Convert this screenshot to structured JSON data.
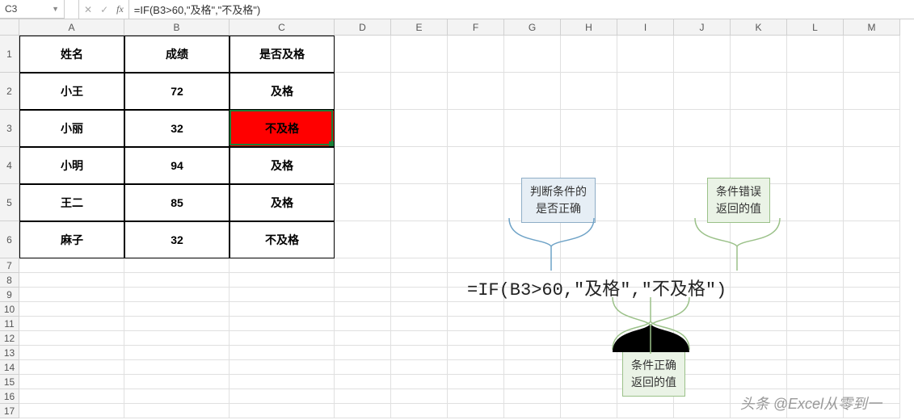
{
  "namebox": "C3",
  "formula": "=IF(B3>60,\"及格\",\"不及格\")",
  "columns": [
    "A",
    "B",
    "C",
    "D",
    "E",
    "F",
    "G",
    "H",
    "I",
    "J",
    "K",
    "L",
    "M"
  ],
  "rows_tall": [
    1,
    2,
    3,
    4,
    5,
    6
  ],
  "rows_short": [
    7,
    8,
    9,
    10,
    11,
    12,
    13,
    14,
    15,
    16,
    17
  ],
  "table": {
    "header": [
      "姓名",
      "成绩",
      "是否及格"
    ],
    "rows": [
      {
        "name": "小王",
        "score": "72",
        "result": "及格"
      },
      {
        "name": "小丽",
        "score": "32",
        "result": "不及格",
        "highlight": true
      },
      {
        "name": "小明",
        "score": "94",
        "result": "及格"
      },
      {
        "name": "王二",
        "score": "85",
        "result": "及格"
      },
      {
        "name": "麻子",
        "score": "32",
        "result": "不及格"
      }
    ]
  },
  "annotations": {
    "cond": {
      "line1": "判断条件的",
      "line2": "是否正确"
    },
    "false": {
      "line1": "条件错误",
      "line2": "返回的值"
    },
    "true": {
      "line1": "条件正确",
      "line2": "返回的值"
    }
  },
  "big_formula": "=IF(B3>60,\"及格\",\"不及格\")",
  "watermark": "头条 @Excel从零到一"
}
